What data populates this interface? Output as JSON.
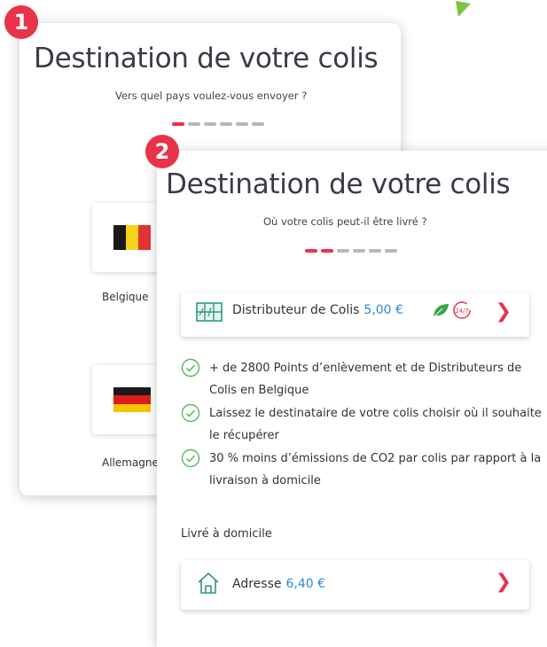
{
  "badges": {
    "one": "1",
    "two": "2"
  },
  "screen1": {
    "title": "Destination de votre colis",
    "subtitle": "Vers quel pays voulez-vous envoyer ?",
    "steps": {
      "total": 6,
      "active": 1
    },
    "countries": [
      {
        "label": "Belgique",
        "flag": "belgium-flag"
      },
      {
        "label": "Allemagne",
        "flag": "germany-flag"
      }
    ]
  },
  "screen2": {
    "title": "Destination de votre colis",
    "subtitle": "Où votre colis peut-il être livré ?",
    "steps": {
      "total": 6,
      "active": 2
    },
    "locker_option": {
      "label": "Distributeur de Colis",
      "price": "5,00 €",
      "icons": [
        "parcel-locker-icon",
        "leaf-icon",
        "clock-24-7-icon",
        "chevron-right-icon"
      ]
    },
    "features": [
      "+ de 2800 Points d’enlèvement et de Distributeurs de Colis en Belgique",
      "Laissez le destinataire de votre colis choisir où il souhaite le récupérer",
      "30 % moins d’émissions de CO2 par colis par rapport à la livraison à domicile"
    ],
    "home_section_label": "Livré à domicile",
    "address_option": {
      "label": "Adresse",
      "price": "6,40 €"
    }
  },
  "colors": {
    "accent": "#e8334a",
    "price": "#2b8bd6",
    "check": "#5cb85c",
    "leaf": "#3aa34a",
    "step_inactive": "#b7b9bf",
    "title": "#3a3a4a"
  },
  "flag_colors": {
    "belgium": [
      "#1a1a1a",
      "#f5d31b",
      "#e33434"
    ],
    "germany": [
      "#1a1a1a",
      "#dd1c1c",
      "#f5c400"
    ]
  }
}
